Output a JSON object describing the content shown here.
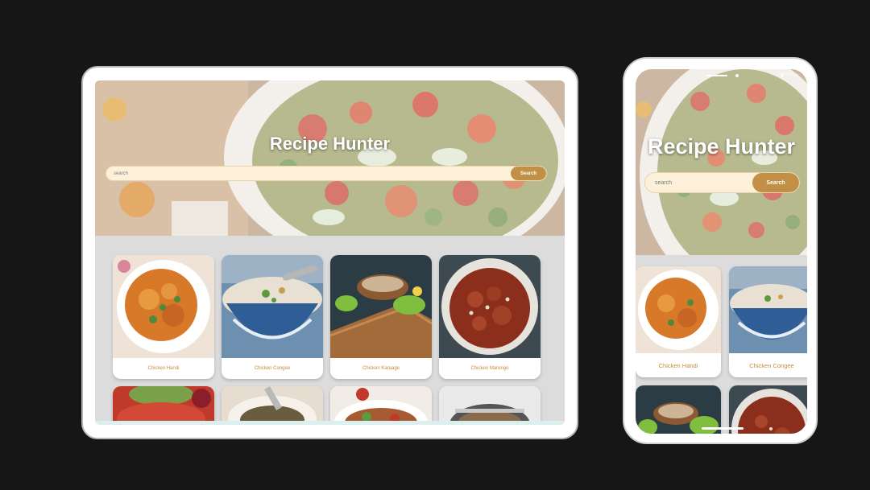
{
  "app": {
    "title": "Recipe Hunter"
  },
  "search": {
    "placeholder": "search",
    "button_label": "Search"
  },
  "recipes": [
    {
      "name": "Chicken Handi"
    },
    {
      "name": "Chicken Congee"
    },
    {
      "name": "Chicken Karaage"
    },
    {
      "name": "Chicken Marengo"
    }
  ],
  "colors": {
    "background": "#161616",
    "accent": "#c18f45",
    "search_field": "#fdf0d9",
    "caption": "#c98a3a",
    "content_background": "#dcdcdc"
  },
  "icons": [
    "signal-icon",
    "wifi-icon",
    "battery-icon"
  ]
}
